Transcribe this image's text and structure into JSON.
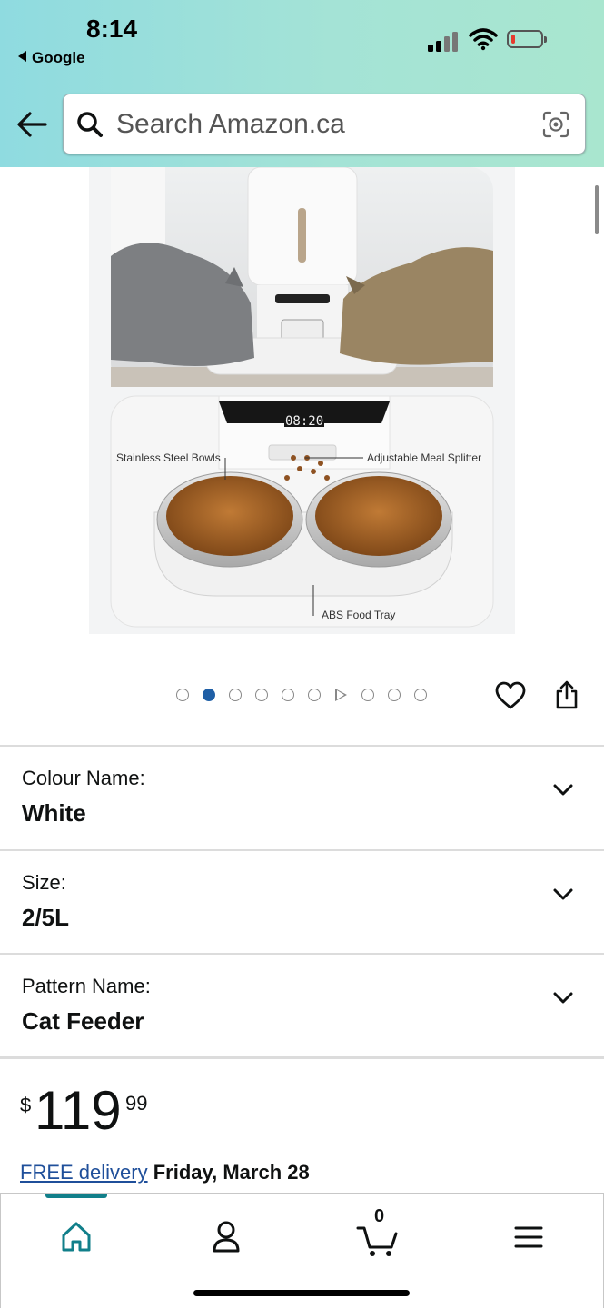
{
  "status_bar": {
    "time": "8:14",
    "back_app": "Google"
  },
  "search": {
    "placeholder": "Search Amazon.ca"
  },
  "product_image": {
    "panel_callouts": {
      "left": "Stainless Steel Bowls",
      "right": "Adjustable Meal Splitter",
      "bottom": "ABS Food Tray"
    },
    "display_top": "08:20",
    "display_main": "08:20"
  },
  "carousel": {
    "count": 10,
    "active_index": 1,
    "video_index": 6
  },
  "variants": [
    {
      "label": "Colour Name:",
      "value": "White"
    },
    {
      "label": "Size:",
      "value": "2/5L"
    },
    {
      "label": "Pattern Name:",
      "value": "Cat Feeder"
    }
  ],
  "price": {
    "symbol": "$",
    "whole": "119",
    "fraction": "99"
  },
  "delivery": {
    "link_text": "FREE delivery",
    "date_text": "Friday, March 28"
  },
  "tabbar": {
    "cart_count": "0",
    "active_tab": "home"
  },
  "colors": {
    "accent": "#117f8a",
    "link": "#1f4f9a",
    "header_start": "#8fdbe0",
    "header_end": "#a9e6cf",
    "dot_active": "#1f5fa6"
  },
  "icons": [
    "back-arrow-icon",
    "search-icon",
    "camera-lens-icon",
    "heart-icon",
    "share-icon",
    "chevron-down-icon",
    "home-icon",
    "account-icon",
    "cart-icon",
    "menu-icon"
  ]
}
